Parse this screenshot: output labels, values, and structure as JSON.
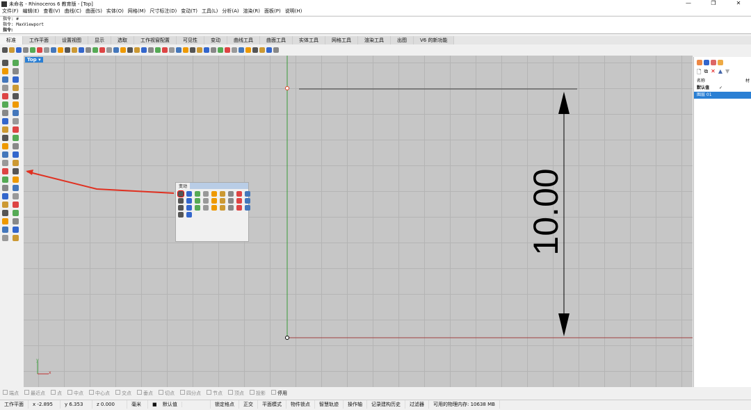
{
  "title": "未命名 - Rhinoceros 6 教育版 - [Top]",
  "window_controls": [
    "—",
    "❐",
    "✕"
  ],
  "menu": [
    "文件(F)",
    "编辑(E)",
    "查看(V)",
    "曲线(C)",
    "曲面(S)",
    "实体(O)",
    "网格(M)",
    "尺寸标注(D)",
    "变动(T)",
    "工具(L)",
    "分析(A)",
    "渲染(R)",
    "面板(P)",
    "说明(H)"
  ],
  "command_history": [
    "指令: #",
    "指令: MaxViewport"
  ],
  "command_prompt": "指令:",
  "tabs": [
    "标准",
    "工作平面",
    "设置视图",
    "显示",
    "选取",
    "工作视窗配置",
    "可见性",
    "变动",
    "曲线工具",
    "曲面工具",
    "实体工具",
    "网格工具",
    "渲染工具",
    "出图",
    "V6 的新功能"
  ],
  "active_tab": "标准",
  "viewport": {
    "label": "Top ▾",
    "dimension_text": "10.00",
    "axis_x": "x",
    "axis_y": "y"
  },
  "floating_panel": {
    "title": "变动"
  },
  "layers": {
    "header": [
      "名称",
      "材"
    ],
    "rows": [
      {
        "name": "默认值",
        "current": "✓"
      },
      {
        "name": "图层 01",
        "selected": true
      }
    ]
  },
  "osnap": [
    "端点",
    "最近点",
    "点",
    "中点",
    "中心点",
    "交点",
    "垂点",
    "切点",
    "四分点",
    "节点",
    "顶点",
    "投影"
  ],
  "osnap_disable": "停用",
  "status": {
    "cplane": "工作平面",
    "x": "x -2.895",
    "y": "y 6.353",
    "z": "z 0.000",
    "units": "毫米",
    "layer": "默认值",
    "items": [
      "锁定格点",
      "正交",
      "平面模式",
      "物件锁点",
      "智慧轨迹",
      "操作轴",
      "记录建构历史",
      "过滤器",
      "可用的物理内存: 10638 MB"
    ]
  },
  "colors": {
    "accent": "#2a7fd4",
    "viewport_bg": "#c6c6c6",
    "arrow": "#e03020"
  }
}
